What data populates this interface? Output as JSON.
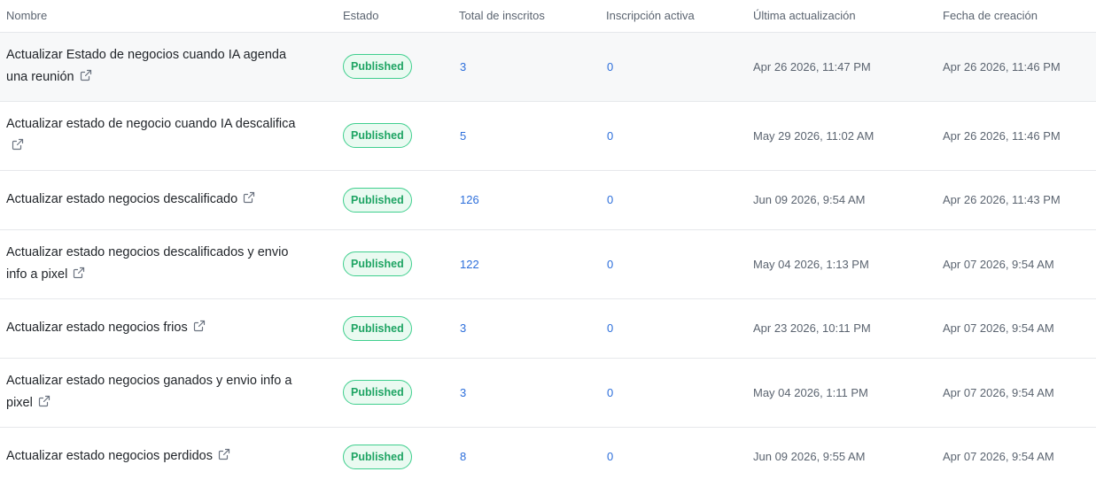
{
  "table": {
    "headers": {
      "name": "Nombre",
      "status": "Estado",
      "total": "Total de inscritos",
      "active": "Inscripción activa",
      "updated": "Última actualización",
      "created": "Fecha de creación"
    },
    "rows": [
      {
        "name": "Actualizar Estado de negocios cuando IA agenda una reunión",
        "status": "Published",
        "total": "3",
        "active": "0",
        "updated": "Apr 26 2026, 11:47 PM",
        "created": "Apr 26 2026, 11:46 PM"
      },
      {
        "name": "Actualizar estado de negocio cuando IA descalifica",
        "status": "Published",
        "total": "5",
        "active": "0",
        "updated": "May 29 2026, 11:02 AM",
        "created": "Apr 26 2026, 11:46 PM"
      },
      {
        "name": "Actualizar estado negocios descalificado",
        "status": "Published",
        "total": "126",
        "active": "0",
        "updated": "Jun 09 2026, 9:54 AM",
        "created": "Apr 26 2026, 11:43 PM"
      },
      {
        "name": "Actualizar estado negocios descalificados y envio info a pixel",
        "status": "Published",
        "total": "122",
        "active": "0",
        "updated": "May 04 2026, 1:13 PM",
        "created": "Apr 07 2026, 9:54 AM"
      },
      {
        "name": "Actualizar estado negocios frios",
        "status": "Published",
        "total": "3",
        "active": "0",
        "updated": "Apr 23 2026, 10:11 PM",
        "created": "Apr 07 2026, 9:54 AM"
      },
      {
        "name": "Actualizar estado negocios ganados y envio info a pixel",
        "status": "Published",
        "total": "3",
        "active": "0",
        "updated": "May 04 2026, 1:11 PM",
        "created": "Apr 07 2026, 9:54 AM"
      },
      {
        "name": "Actualizar estado negocios perdidos",
        "status": "Published",
        "total": "8",
        "active": "0",
        "updated": "Jun 09 2026, 9:55 AM",
        "created": "Apr 07 2026, 9:54 AM"
      }
    ]
  },
  "icons": {
    "external_link": "external-link-icon"
  },
  "colors": {
    "status_published_border": "#3fcf8e",
    "status_published_text": "#1ea463",
    "link_number": "#2d6fdb"
  }
}
